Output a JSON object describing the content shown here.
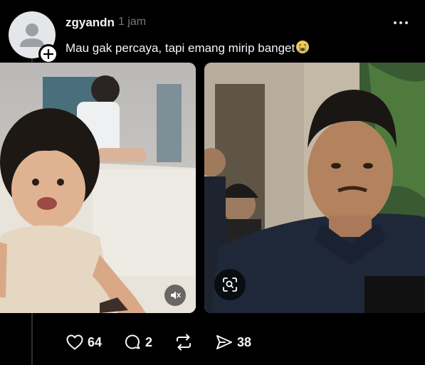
{
  "post": {
    "username": "zgyandn",
    "time": "1 jam",
    "caption": "Mau gak percaya, tapi emang mirip banget",
    "caption_emoji": "loudly-crying-face-icon"
  },
  "media": [
    {
      "kind": "video",
      "description_icon": "mute-icon"
    },
    {
      "kind": "photo",
      "description_icon": "visual-search-icon"
    }
  ],
  "actions": {
    "likes": "64",
    "replies": "2",
    "reposts": "",
    "shares": "38"
  },
  "colors": {
    "background": "#000000",
    "text": "#f3f5f7",
    "muted": "#777777",
    "thread_line": "#2f2f2f"
  }
}
